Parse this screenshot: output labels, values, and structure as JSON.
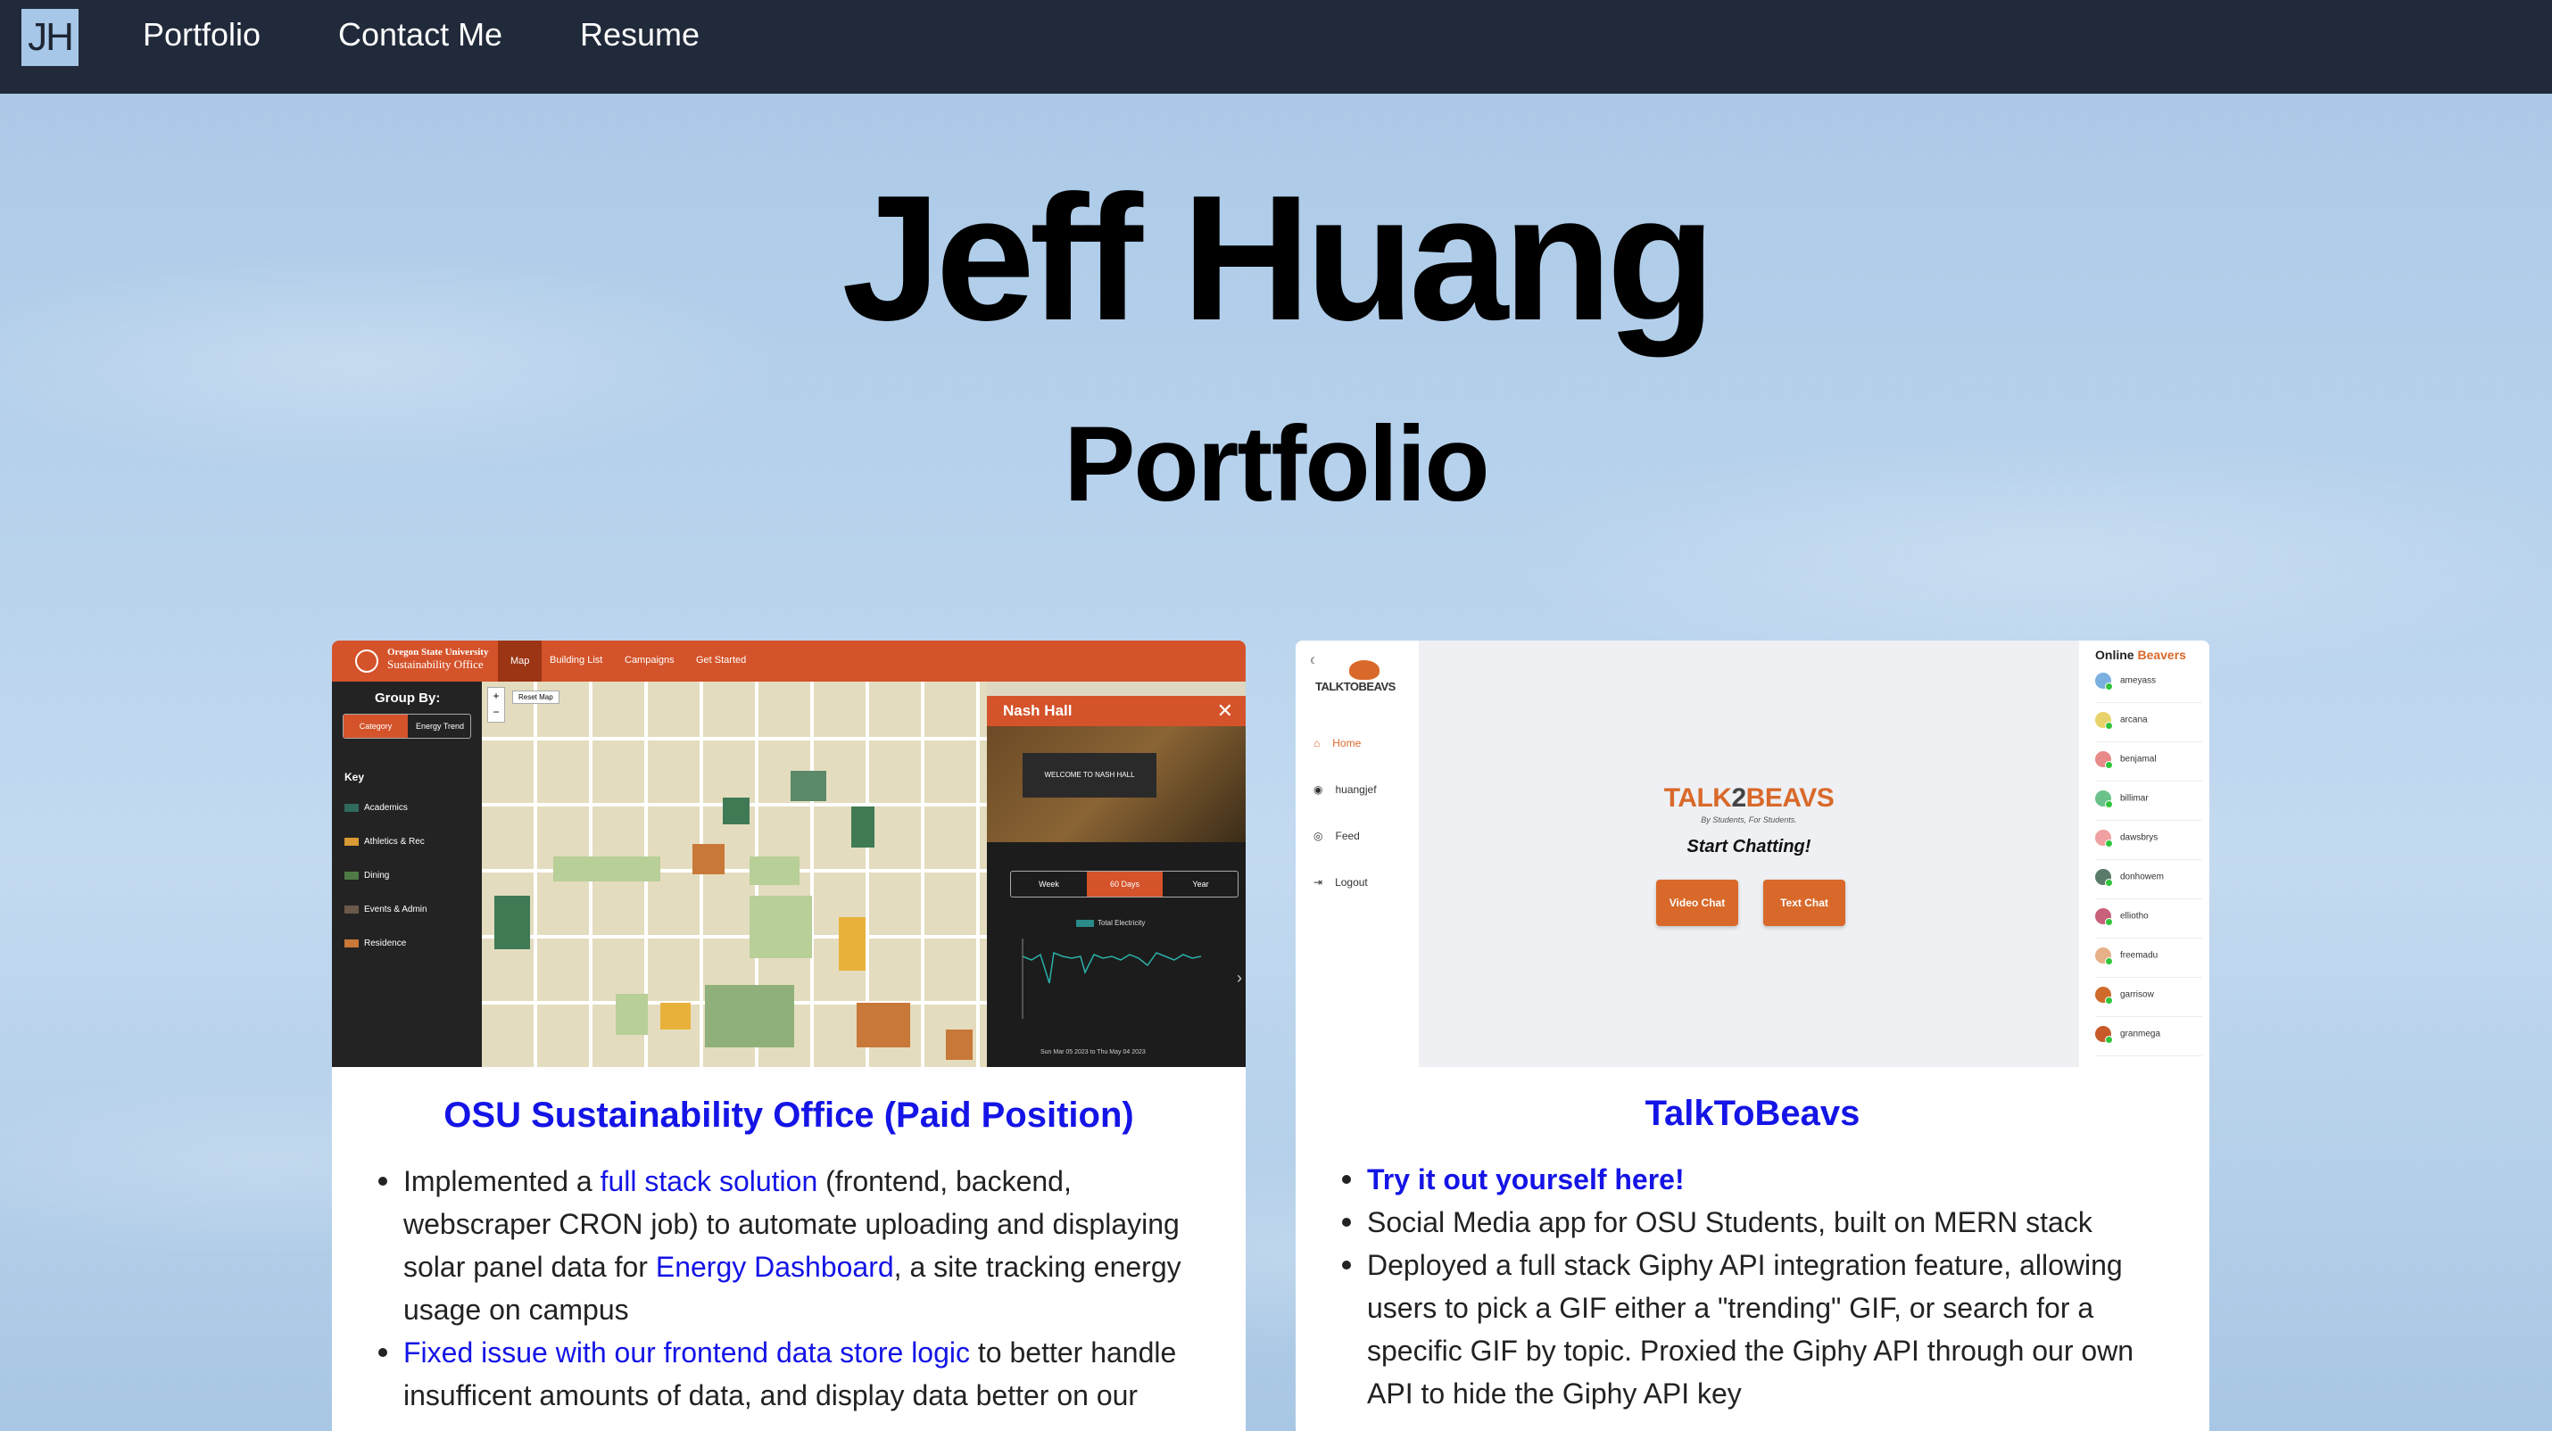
{
  "nav": {
    "logo": "JH",
    "links": [
      "Portfolio",
      "Contact Me",
      "Resume"
    ]
  },
  "hero": {
    "name": "Jeff Huang",
    "subtitle": "Portfolio"
  },
  "cards": [
    {
      "title": "OSU Sustainability Office (Paid Position)",
      "screenshot": {
        "brand_line1": "Oregon State University",
        "brand_line2": "Sustainability Office",
        "tabs": [
          "Map",
          "Building List",
          "Campaigns",
          "Get Started"
        ],
        "group_by": "Group By:",
        "toggle": [
          "Category",
          "Energy Trend"
        ],
        "key_title": "Key",
        "key_items": [
          {
            "label": "Academics",
            "color": "#2f6a5e"
          },
          {
            "label": "Athletics & Rec",
            "color": "#d79a35"
          },
          {
            "label": "Dining",
            "color": "#4f7a45"
          },
          {
            "label": "Events & Admin",
            "color": "#6b5a4a"
          },
          {
            "label": "Residence",
            "color": "#c87838"
          }
        ],
        "reset_map": "Reset Map",
        "panel_title": "Nash Hall",
        "photo_sign": "WELCOME TO NASH HALL",
        "periods": [
          "Week",
          "60 Days",
          "Year"
        ],
        "active_period": "60 Days",
        "chart_legend": "Total Electricity",
        "chart_footer": "Sun Mar 05 2023 to Thu May 04 2023"
      },
      "bullets": [
        {
          "pre": "Implemented a ",
          "link": "full stack solution",
          "post": " (frontend, backend, webscraper CRON job) to automate uploading and displaying solar panel data for ",
          "link2": "Energy Dashboard",
          "post2": ", a site tracking energy usage on campus"
        },
        {
          "pre": "",
          "link": "Fixed issue with our frontend data store logic",
          "post": " to better handle insufficent amounts of data, and display data better on our"
        }
      ]
    },
    {
      "title": "TalkToBeavs",
      "screenshot": {
        "logo": "TALKTOBEAVS",
        "nav": [
          "Home",
          "huangjef",
          "Feed",
          "Logout"
        ],
        "brand_a": "TALK",
        "brand_b": "2",
        "brand_c": "BEAVS",
        "tagline": "By Students, For Students.",
        "start": "Start Chatting!",
        "buttons": [
          "Video Chat",
          "Text Chat"
        ],
        "online_title_a": "Online ",
        "online_title_b": "Beavers",
        "users": [
          {
            "name": "ameyass",
            "color": "#7ab0e0"
          },
          {
            "name": "arcana",
            "color": "#e8d36a"
          },
          {
            "name": "benjamal",
            "color": "#e88a8a"
          },
          {
            "name": "billimar",
            "color": "#6ac28a"
          },
          {
            "name": "dawsbrys",
            "color": "#f0a0a0"
          },
          {
            "name": "donhowem",
            "color": "#5a7a6a"
          },
          {
            "name": "elliotho",
            "color": "#c8607a"
          },
          {
            "name": "freemadu",
            "color": "#e8b088"
          },
          {
            "name": "garrisow",
            "color": "#d06a2a"
          },
          {
            "name": "granmega",
            "color": "#c85a2a"
          }
        ]
      },
      "bullets": [
        {
          "link": "Try it out yourself here!"
        },
        {
          "text": "Social Media app for OSU Students, built on MERN stack"
        },
        {
          "text": "Deployed a full stack Giphy API integration feature, allowing users to pick a GIF either a \"trending\" GIF, or search for a specific GIF by topic. Proxied the Giphy API through our own API to hide the Giphy API key"
        }
      ]
    }
  ],
  "colors": {
    "nav_bg": "#212a3a",
    "link": "#1414e6",
    "osu_orange": "#d4532a",
    "ttb_orange": "#d9692a"
  }
}
